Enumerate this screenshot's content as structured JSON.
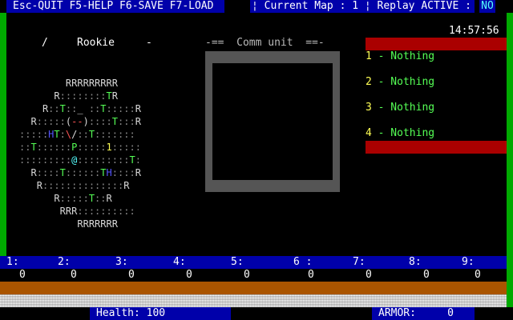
{
  "topbar": {
    "keys": "Esc-QUIT F5-HELP F6-SAVE F7-LOAD",
    "map_label": "¦ Current Map : 1 ¦ Replay ACTIVE :",
    "replay_flag": "NO"
  },
  "player": {
    "weapon_glyph": "/",
    "rank": "Rookie",
    "dash": "-"
  },
  "comm": {
    "title": "-==  Comm unit  ==-"
  },
  "clock": "14:57:56",
  "inventory": [
    {
      "num": "1",
      "label": " - Nothing"
    },
    {
      "num": "2",
      "label": " - Nothing"
    },
    {
      "num": "3",
      "label": " - Nothing"
    },
    {
      "num": "4",
      "label": " - Nothing"
    }
  ],
  "weapon_slots": [
    "1:",
    "2:",
    "3:",
    "4:",
    "5:",
    "6 :",
    "7:",
    "8:",
    "9:"
  ],
  "weapon_counts": [
    "0",
    "0",
    "0",
    "0",
    "0",
    "0",
    "0",
    "0",
    "0"
  ],
  "status": {
    "health_label": "Health:",
    "health_value": "100",
    "armor_label": "ARMOR:",
    "armor_value": "0"
  },
  "colors": {
    "panel_blue": "#0000aa",
    "side_green": "#00aa00",
    "band_red": "#aa0000",
    "brown": "#aa5500",
    "text_green": "#55ff55"
  },
  "map_rows": [
    "        RRRRRRRRR      ",
    "      R::::::::TR      ",
    "    R::T::_ ::T:::::R  ",
    "  R:::::(--)::::T:::R  ",
    ":::::HT:\\/::T:::::::   ",
    "::T::::::P:::::1:::::  ",
    ":::::::::@:::::::::T:  ",
    "  R::::T::::::TH::::R  ",
    "   R::::::::::::::R    ",
    "      R:::::T::R       ",
    "       RRR::::::::::   ",
    "          RRRRRRR      "
  ]
}
